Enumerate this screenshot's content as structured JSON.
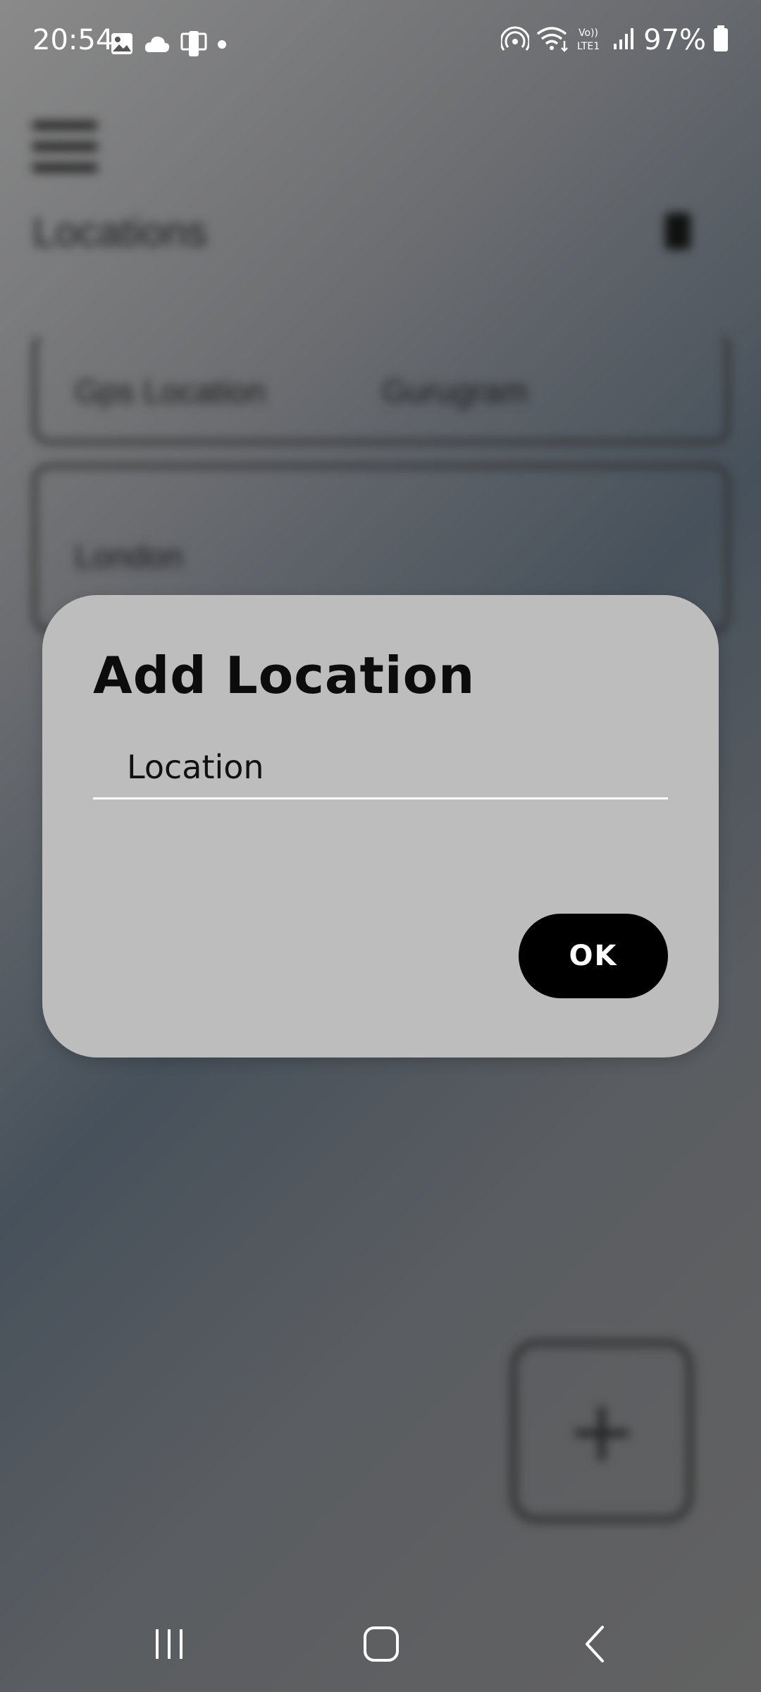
{
  "status_bar": {
    "time": "20:54",
    "battery": "97%",
    "left_icons": [
      "image-icon",
      "cloud-icon",
      "device-icon",
      "dot-icon"
    ],
    "right_icons": [
      "hotspot-icon",
      "wifi-icon",
      "volte-icon",
      "signal-icon",
      "battery-icon"
    ]
  },
  "background": {
    "title": "Locations",
    "cards": [
      {
        "items": [
          "Gps Location",
          "Gurugram"
        ]
      },
      {
        "items": [
          "London"
        ]
      }
    ]
  },
  "dialog": {
    "title": "Add Location",
    "input_placeholder": "Location",
    "input_value": "",
    "ok_label": "OK"
  },
  "nav_bar": {
    "items": [
      "recents-icon",
      "home-icon",
      "back-icon"
    ]
  }
}
